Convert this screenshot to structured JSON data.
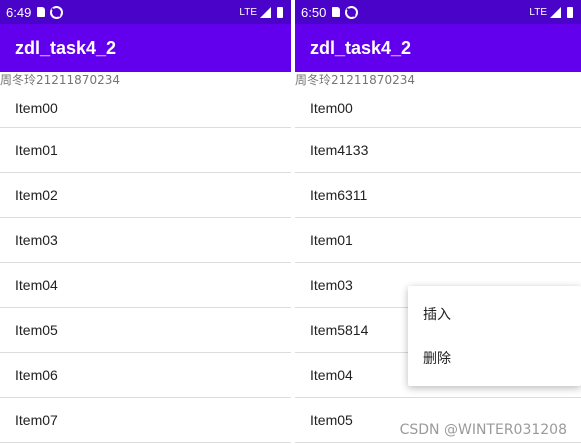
{
  "left": {
    "status": {
      "time": "6:49",
      "network": "LTE"
    },
    "app_title": "zdl_task4_2",
    "subtitle": "周冬玲21211870234",
    "items": [
      "Item00",
      "Item01",
      "Item02",
      "Item03",
      "Item04",
      "Item05",
      "Item06",
      "Item07"
    ]
  },
  "right": {
    "status": {
      "time": "6:50",
      "network": "LTE"
    },
    "app_title": "zdl_task4_2",
    "subtitle": "周冬玲21211870234",
    "items": [
      "Item00",
      "Item4133",
      "Item6311",
      "Item01",
      "Item03",
      "Item5814",
      "Item04",
      "Item05"
    ],
    "context_menu": {
      "insert": "插入",
      "delete": "删除"
    }
  },
  "watermark": "CSDN @WINTER031208",
  "colors": {
    "status_bar": "#4a03c8",
    "app_bar": "#6200ee"
  },
  "icons": [
    "sim-card-icon",
    "do-not-disturb-icon",
    "signal-icon",
    "battery-icon"
  ]
}
